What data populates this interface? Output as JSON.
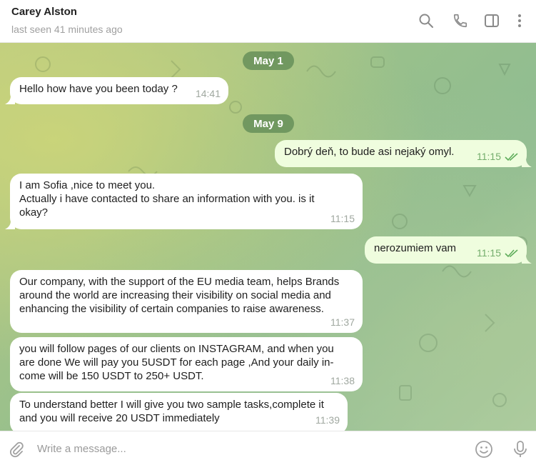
{
  "header": {
    "name": "Carey Alston",
    "status": "last seen 41 minutes ago",
    "icons": [
      "search-icon",
      "phone-icon",
      "sidebar-toggle-icon",
      "more-vertical-icon"
    ]
  },
  "dates": [
    "May 1",
    "May 9"
  ],
  "messages": [
    {
      "dir": "in",
      "lines": [
        "Hello how have you been today ?"
      ],
      "time": "14:41"
    },
    {
      "dir": "out",
      "lines": [
        "Dobrý deň, to bude asi nejaký omyl."
      ],
      "time": "11:15",
      "read": true
    },
    {
      "dir": "in",
      "lines": [
        "I am Sofia ,nice to meet you.",
        "Actually i have contacted to share an information with you. is it",
        "okay?"
      ],
      "time": "11:15"
    },
    {
      "dir": "out",
      "lines": [
        "nerozumiem vam"
      ],
      "time": "11:15",
      "read": true
    },
    {
      "dir": "in",
      "lines": [
        "Our company, with the support of the EU media team, helps Brands",
        "around the world are increasing their visibility on social media and",
        "enhancing the visibility of certain companies to raise awareness."
      ],
      "time": "11:37"
    },
    {
      "dir": "in",
      "lines": [
        "you will follow pages of our clients on INSTAGRAM, and when you",
        "are done We will pay you 5USDT for each page ,And your daily in-",
        "come will be 150 USDT to 250+ USDT."
      ],
      "time": "11:38"
    },
    {
      "dir": "in",
      "lines": [
        "To understand better I will give you two sample tasks,complete it",
        "and you will receive 20 USDT immediately"
      ],
      "time": "11:39"
    }
  ],
  "composer": {
    "placeholder": "Write a message...",
    "icons": [
      "attach-icon",
      "emoji-icon",
      "microphone-icon"
    ]
  },
  "colors": {
    "incoming_bubble": "#ffffff",
    "outgoing_bubble": "#effdde",
    "read_check": "#5fad5b",
    "date_pill": "#608a56"
  }
}
